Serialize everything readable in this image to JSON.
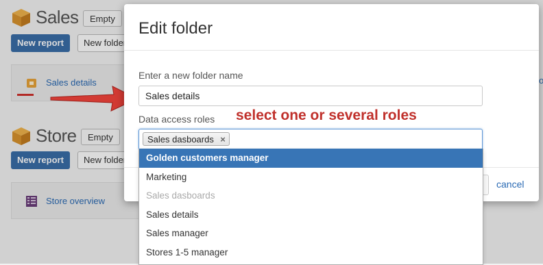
{
  "background": {
    "sections": [
      {
        "title": "Sales",
        "filter_label": "Empty",
        "new_report_label": "New report",
        "new_folder_label": "New folder",
        "card_label": "Sales details"
      },
      {
        "title": "Store",
        "filter_label": "Empty",
        "new_report_label": "New report",
        "new_folder_label": "New folder",
        "card_label": "Store overview"
      }
    ],
    "edge_fragment": "o"
  },
  "modal": {
    "title": "Edit folder",
    "name_label": "Enter a new folder name",
    "name_value": "Sales details",
    "roles_label": "Data access roles",
    "selected_roles": [
      "Sales dasboards"
    ],
    "remove_glyph": "×",
    "cancel_label": "cancel"
  },
  "dropdown": {
    "options": [
      {
        "label": "Golden customers manager",
        "state": "highlighted"
      },
      {
        "label": "Marketing",
        "state": "normal"
      },
      {
        "label": "Sales dasboards",
        "state": "disabled"
      },
      {
        "label": "Sales details",
        "state": "normal"
      },
      {
        "label": "Sales manager",
        "state": "normal"
      },
      {
        "label": "Stores 1-5 manager",
        "state": "normal"
      }
    ]
  },
  "annotation": {
    "text": "select one or several roles"
  },
  "colors": {
    "primary": "#3a6ea8",
    "highlight": "#3875b6",
    "annotation_red": "#c0302b",
    "link": "#2a6ab4",
    "box_icon": "#e8a33a"
  }
}
